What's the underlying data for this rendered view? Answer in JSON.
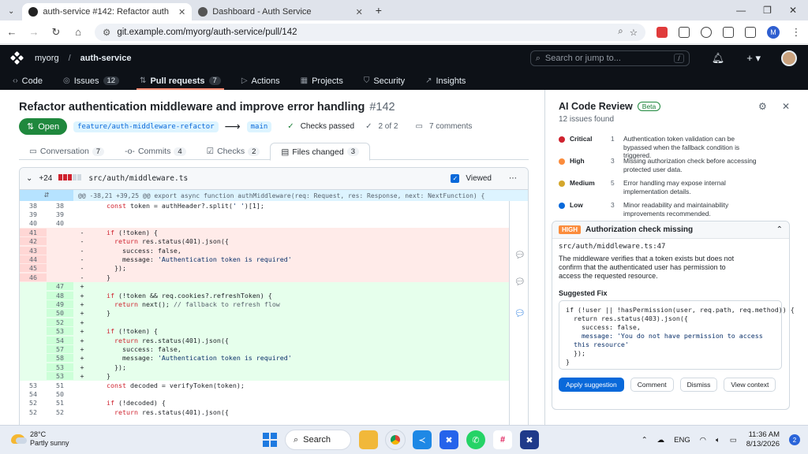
{
  "browser": {
    "tabs": [
      {
        "title": "auth-service #142: Refactor auth"
      },
      {
        "title": "Dashboard - Auth Service"
      }
    ],
    "url": "git.example.com/myorg/auth-service/pull/142",
    "profile_initial": "M"
  },
  "header": {
    "org": "myorg",
    "separator": "/",
    "repo": "auth-service",
    "search_placeholder": "Search or jump to...",
    "search_shortcut": "/"
  },
  "repo_nav": [
    {
      "label": "Code",
      "icon": "code-icon"
    },
    {
      "label": "Issues",
      "icon": "issue-icon",
      "count": "12"
    },
    {
      "label": "Pull requests",
      "icon": "pr-icon",
      "count": "7"
    },
    {
      "label": "Actions",
      "icon": "play-icon"
    },
    {
      "label": "Projects",
      "icon": "table-icon"
    },
    {
      "label": "Security",
      "icon": "shield-icon"
    },
    {
      "label": "Insights",
      "icon": "graph-icon"
    }
  ],
  "pr": {
    "title": "Refactor authentication middleware and improve error handling",
    "number": "#142",
    "state": "Open",
    "head_branch": "feature/auth-middleware-refactor",
    "base_branch": "main",
    "checks": "Checks passed",
    "checks_count": "2 of 2",
    "comments": "7 comments"
  },
  "pr_tabs": [
    {
      "label": "Conversation",
      "count": "7"
    },
    {
      "label": "Commits",
      "count": "4"
    },
    {
      "label": "Checks",
      "count": "2"
    },
    {
      "label": "Files changed",
      "count": "3"
    }
  ],
  "diff": {
    "additions": "+24",
    "file": "src/auth/middleware.ts",
    "viewed_label": "Viewed",
    "hunk": "@@ -38,21 +39,25 @@ export async function authMiddleware(req: Request, res: Response, next: NextFunction) {",
    "lines": [
      {
        "type": "ctx",
        "old": "38",
        "new": "38",
        "code": "    const token = authHeader?.split(' ')[1];"
      },
      {
        "type": "ctx",
        "old": "39",
        "new": "39",
        "code": ""
      },
      {
        "type": "ctx",
        "old": "40",
        "new": "40",
        "code": ""
      },
      {
        "type": "del",
        "old": "41",
        "new": "",
        "code": "    if (!token) {"
      },
      {
        "type": "del",
        "old": "42",
        "new": "",
        "code": "      return res.status(401).json({"
      },
      {
        "type": "del",
        "old": "43",
        "new": "",
        "code": "        success: false,"
      },
      {
        "type": "del",
        "old": "44",
        "new": "",
        "code": "        message: 'Authentication token is required'"
      },
      {
        "type": "del",
        "old": "45",
        "new": "",
        "code": "      });"
      },
      {
        "type": "del",
        "old": "46",
        "new": "",
        "code": "    }"
      },
      {
        "type": "add",
        "old": "",
        "new": "47",
        "code": ""
      },
      {
        "type": "add",
        "old": "",
        "new": "48",
        "code": "    if (!token && req.cookies?.refreshToken) {"
      },
      {
        "type": "add",
        "old": "",
        "new": "49",
        "code": "      return next(); // fallback to refresh flow"
      },
      {
        "type": "add",
        "old": "",
        "new": "50",
        "code": "    }"
      },
      {
        "type": "add",
        "old": "",
        "new": "52",
        "code": ""
      },
      {
        "type": "add",
        "old": "",
        "new": "53",
        "code": "    if (!token) {"
      },
      {
        "type": "add",
        "old": "",
        "new": "54",
        "code": "      return res.status(401).json({"
      },
      {
        "type": "add",
        "old": "",
        "new": "57",
        "code": "        success: false,"
      },
      {
        "type": "add",
        "old": "",
        "new": "58",
        "code": "        message: 'Authentication token is required'"
      },
      {
        "type": "add",
        "old": "",
        "new": "53",
        "code": "      });"
      },
      {
        "type": "add",
        "old": "",
        "new": "53",
        "code": "    }"
      },
      {
        "type": "ctx",
        "old": "53",
        "new": "51",
        "code": "    const decoded = verifyToken(token);"
      },
      {
        "type": "ctx",
        "old": "54",
        "new": "50",
        "code": ""
      },
      {
        "type": "ctx",
        "old": "52",
        "new": "51",
        "code": "    if (!decoded) {"
      },
      {
        "type": "ctx",
        "old": "52",
        "new": "52",
        "code": "      return res.status(401).json({"
      }
    ]
  },
  "review": {
    "title": "AI Code Review",
    "badge": "Beta",
    "summary": "12 issues found",
    "severities": [
      {
        "label": "Critical",
        "count": "1",
        "color": "#cf222e",
        "desc": "Authentication token validation can be bypassed when the fallback condition is triggered."
      },
      {
        "label": "High",
        "count": "3",
        "color": "#fb8c3c",
        "desc": "Missing authorization check before accessing protected user data."
      },
      {
        "label": "Medium",
        "count": "5",
        "color": "#d4a72c",
        "desc": "Error handling may expose internal implementation details."
      },
      {
        "label": "Low",
        "count": "3",
        "color": "#0969da",
        "desc": "Minor readability and maintainability improvements recommended."
      }
    ],
    "issue": {
      "severity": "HIGH",
      "title": "Authorization check missing",
      "location": "src/auth/middleware.ts:47",
      "description": "The middleware verifies that a token exists but does not confirm that the authenticated user has permission to access the requested resource.",
      "suggested_label": "Suggested Fix",
      "code": [
        "if (!user || !hasPermission(user, req.path, req.method)) {",
        "  return res.status(403).json({",
        "    success: false,",
        "    message: 'You do not have permission to access",
        "  this resource'",
        "  });",
        "}"
      ],
      "actions": [
        "Apply suggestion",
        "Comment",
        "Dismiss",
        "View context"
      ]
    }
  },
  "taskbar": {
    "temp": "28°C",
    "weather": "Partly sunny",
    "search": "Search",
    "lang": "ENG",
    "time": "11:36 AM",
    "date": "8/13/2026",
    "notifications": "2"
  }
}
